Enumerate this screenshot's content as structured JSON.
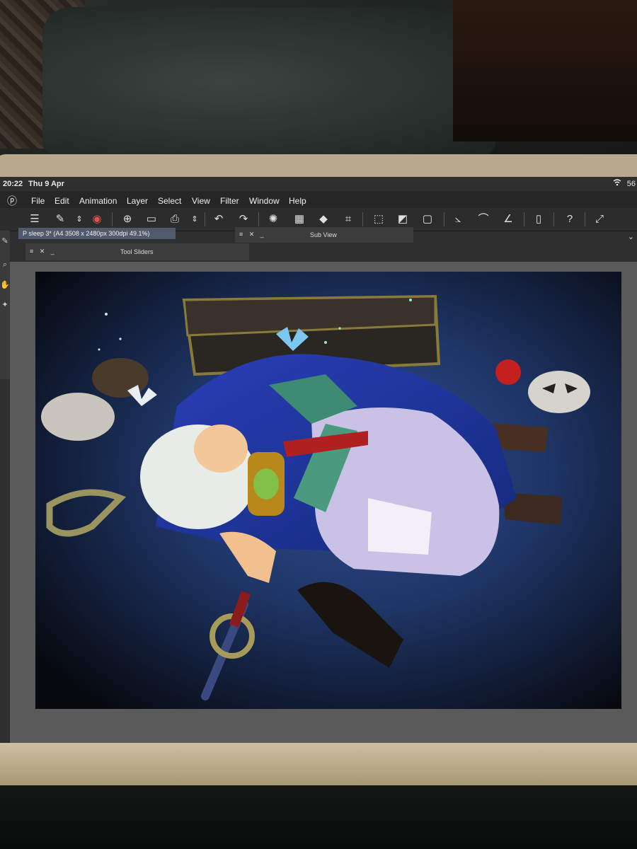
{
  "status_bar": {
    "time": "20:22",
    "date": "Thu 9 Apr",
    "battery": "56"
  },
  "menu": [
    "File",
    "Edit",
    "Animation",
    "Layer",
    "Select",
    "View",
    "Filter",
    "Window",
    "Help"
  ],
  "document_tab": "P sleep 3* (A4 3508 x 2480px 300dpi 49.1%)",
  "panels": {
    "sub_view": {
      "controls": "≡ ✕ _",
      "title": "Sub View"
    },
    "tool_sliders": {
      "controls": "≡ ✕ _",
      "title": "Tool Sliders"
    }
  },
  "toolbar_icons": [
    "menu-icon",
    "new-document-icon",
    "stepper-icon",
    "bucket-icon",
    "new-file-icon",
    "open-folder-icon",
    "save-icon",
    "undo-icon",
    "redo-icon",
    "loading-icon",
    "layer-icon",
    "fill-icon",
    "transform-icon",
    "deselect-icon",
    "invert-selection-icon",
    "selection-border-icon",
    "correct-line-icon",
    "smooth-icon",
    "ruler-icon",
    "companion-icon",
    "help-icon",
    "fullscreen-icon"
  ],
  "colors": {
    "menubar": "#262626",
    "tab_active": "#505a6a",
    "canvas_bg": "#5a5a5a"
  }
}
